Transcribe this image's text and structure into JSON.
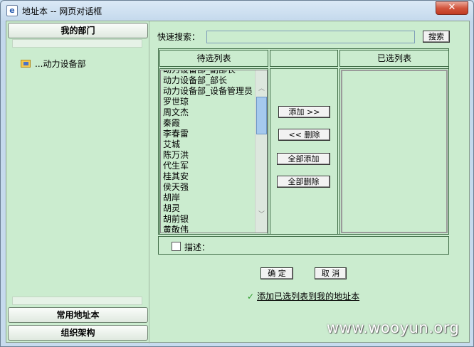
{
  "window": {
    "title": "地址本 -- 网页对话框",
    "close_icon": "close-icon"
  },
  "left_panel": {
    "my_department": "我的部门",
    "tree_item": "...动力设备部",
    "common_address_book": "常用地址本",
    "org_structure": "组织架构"
  },
  "search": {
    "label": "快速搜索：",
    "value": "",
    "button": "搜索"
  },
  "lists": {
    "candidate_header": "待选列表",
    "middle_header": "",
    "selected_header": "已选列表",
    "candidates": [
      "动力设备部_副部长",
      "动力设备部_部长",
      "动力设备部_设备管理员",
      "罗世琼",
      "周文杰",
      "秦霞",
      "李春雷",
      "艾城",
      "陈万洪",
      "代生军",
      "桂其安",
      "侯天强",
      "胡岸",
      "胡灵",
      "胡前银",
      "黄敬伟"
    ],
    "selected": []
  },
  "actions": {
    "add": "添加 >>",
    "remove": "<< 删除",
    "add_all": "全部添加",
    "remove_all": "全部删除"
  },
  "description": {
    "label": "描述：",
    "checked": false
  },
  "footer": {
    "confirm": "确 定",
    "cancel": "取 消",
    "add_to_book": "添加已选列表到我的地址本"
  },
  "watermark": "www.wooyun.org"
}
